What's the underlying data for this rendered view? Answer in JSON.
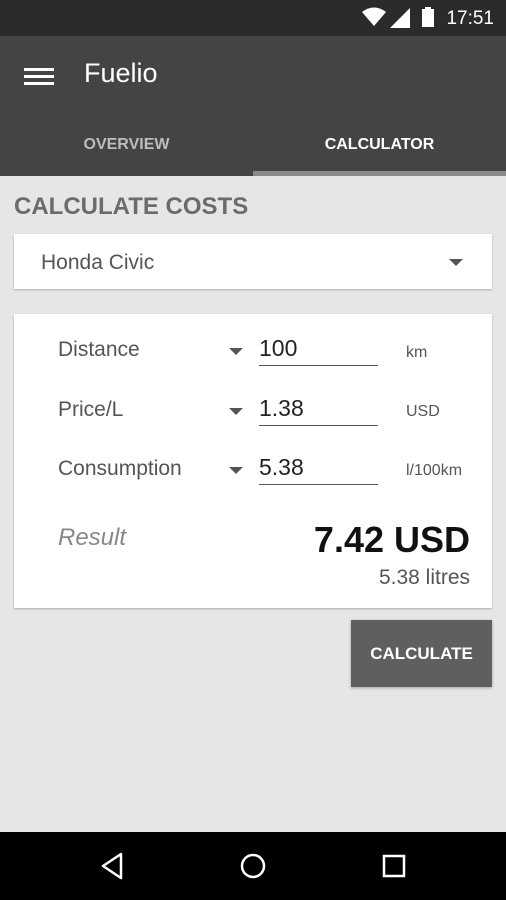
{
  "status_bar": {
    "time": "17:51",
    "icons": [
      "wifi-icon",
      "signal-icon",
      "battery-icon"
    ]
  },
  "app_bar": {
    "title": "Fuelio",
    "menu_icon": "hamburger-menu-icon"
  },
  "tabs": [
    {
      "label": "OVERVIEW",
      "active": false
    },
    {
      "label": "CALCULATOR",
      "active": true
    }
  ],
  "section_title": "CALCULATE COSTS",
  "vehicle": {
    "selected": "Honda Civic"
  },
  "calculator": {
    "rows": [
      {
        "label": "Distance",
        "value": "100",
        "unit": "km"
      },
      {
        "label": "Price/L",
        "value": "1.38",
        "unit": "USD"
      },
      {
        "label": "Consumption",
        "value": "5.38",
        "unit": "l/100km"
      }
    ],
    "result_label": "Result",
    "result_value": "7.42 USD",
    "result_litres": "5.38 litres"
  },
  "actions": {
    "calculate_label": "CALCULATE"
  },
  "nav_bar": {
    "icons": [
      "back-icon",
      "home-icon",
      "recent-apps-icon"
    ]
  },
  "colors": {
    "app_bar": "#444444",
    "status_bar": "#2b2b2b",
    "background": "#e6e6e6",
    "button": "#5f5f5f"
  }
}
